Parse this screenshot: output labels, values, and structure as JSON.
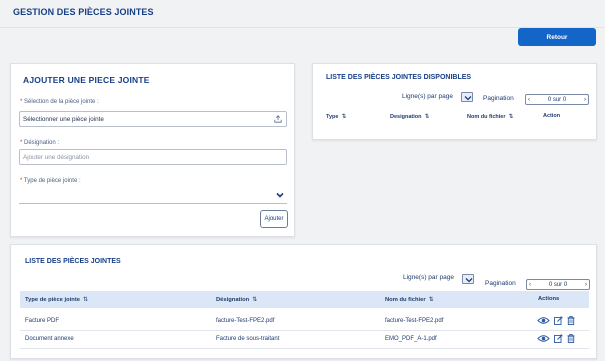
{
  "page": {
    "title": "Gestion des pièces jointes",
    "back_button": "Retour"
  },
  "form": {
    "title": "Ajouter une piece jointe",
    "selection": {
      "label": "Sélection de la pièce jointe :",
      "value": "Sélectionner une pièce jointe"
    },
    "designation": {
      "label": "Désignation :",
      "placeholder": "Ajouter une désignation"
    },
    "type": {
      "label": "Type de pièce jointe :",
      "value": ""
    },
    "add_button": "Ajouter"
  },
  "available": {
    "title": "Liste des pièces jointes disponibles",
    "lines_per_page_label": "Ligne(s) par page",
    "pagination_label": "Pagination",
    "pager_text": "0 sur 0",
    "columns": [
      "Type",
      "Designation",
      "Nom du fichier",
      "Action"
    ]
  },
  "attachments": {
    "title": "Liste des pièces jointes",
    "lines_per_page_label": "Ligne(s) par page",
    "pagination_label": "Pagination",
    "pager_text": "0 sur 0",
    "columns": [
      "Type de pièce jointe",
      "Désignation",
      "Nom du fichier",
      "Actions"
    ],
    "rows": [
      {
        "type": "Facture PDF",
        "designation": "facture-Test-FPE2.pdf",
        "filename": "facture-Test-FPE2.pdf"
      },
      {
        "type": "Document annexe",
        "designation": "Facture de sous-traitant",
        "filename": "EMO_PDF_A-1.pdf"
      }
    ]
  },
  "icons": {
    "sort": "sort-arrows-icon",
    "upload": "upload-icon",
    "chevron": "chevron-down-icon",
    "view": "eye-icon",
    "edit": "edit-icon",
    "delete": "trash-icon"
  },
  "colors": {
    "primary": "#1465c8",
    "title": "#173f86",
    "required": "#d0312d",
    "table_header_bg": "#dbe6f6"
  }
}
